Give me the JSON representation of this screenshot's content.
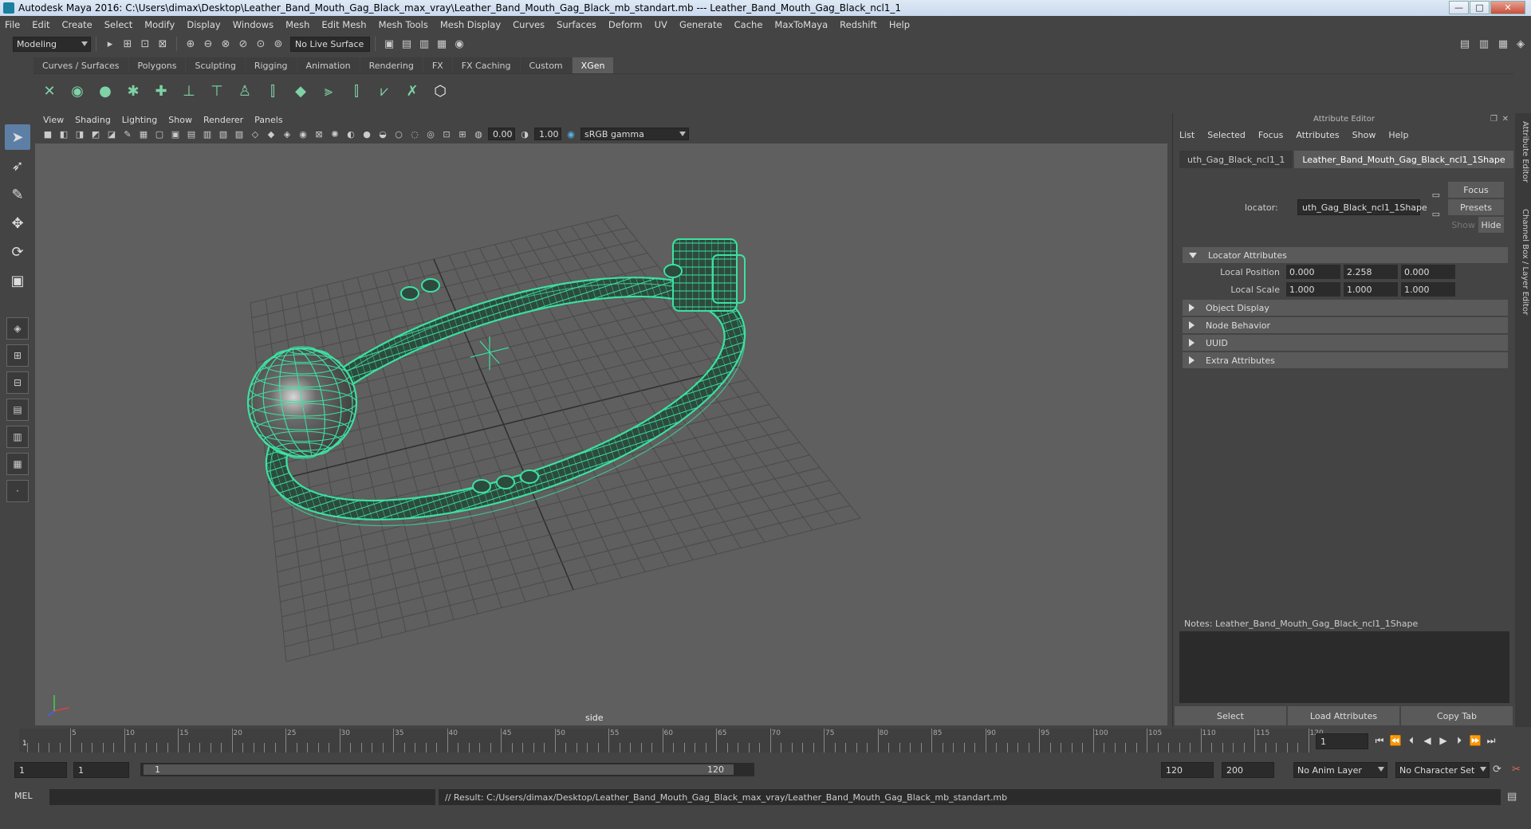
{
  "window": {
    "title": "Autodesk Maya 2016: C:\\Users\\dimax\\Desktop\\Leather_Band_Mouth_Gag_Black_max_vray\\Leather_Band_Mouth_Gag_Black_mb_standart.mb   ---   Leather_Band_Mouth_Gag_Black_ncl1_1",
    "minimize": "—",
    "maximize": "□",
    "close": "✕"
  },
  "menubar": [
    "File",
    "Edit",
    "Create",
    "Select",
    "Modify",
    "Display",
    "Windows",
    "Mesh",
    "Edit Mesh",
    "Mesh Tools",
    "Mesh Display",
    "Curves",
    "Surfaces",
    "Deform",
    "UV",
    "Generate",
    "Cache",
    "MaxToMaya",
    "Redshift",
    "Help"
  ],
  "statusline": {
    "mode": "Modeling",
    "live_surface": "No Live Surface"
  },
  "shelf_tabs": [
    {
      "label": "Curves / Surfaces",
      "active": false
    },
    {
      "label": "Polygons",
      "active": false
    },
    {
      "label": "Sculpting",
      "active": false
    },
    {
      "label": "Rigging",
      "active": false
    },
    {
      "label": "Animation",
      "active": false
    },
    {
      "label": "Rendering",
      "active": false
    },
    {
      "label": "FX",
      "active": false
    },
    {
      "label": "FX Caching",
      "active": false
    },
    {
      "label": "Custom",
      "active": false
    },
    {
      "label": "XGen",
      "active": true
    }
  ],
  "viewport": {
    "menu": [
      "View",
      "Shading",
      "Lighting",
      "Show",
      "Renderer",
      "Panels"
    ],
    "exposure": "0.00",
    "gamma": "1.00",
    "color_space": "sRGB gamma",
    "camera": "side",
    "wire_color": "#3de0a0",
    "bg_color": "#5f5f5f"
  },
  "attribute_editor": {
    "title": "Attribute Editor",
    "menu": [
      "List",
      "Selected",
      "Focus",
      "Attributes",
      "Show",
      "Help"
    ],
    "tabs": [
      "uth_Gag_Black_ncl1_1",
      "Leather_Band_Mouth_Gag_Black_ncl1_1Shape"
    ],
    "buttons": {
      "focus": "Focus",
      "presets": "Presets",
      "show": "Show",
      "hide": "Hide"
    },
    "locator_label": "locator:",
    "locator_value": "uth_Gag_Black_ncl1_1Shape",
    "sections": {
      "locator_attributes": "Locator Attributes",
      "object_display": "Object Display",
      "node_behavior": "Node Behavior",
      "uuid": "UUID",
      "extra_attributes": "Extra Attributes"
    },
    "local_position": {
      "label": "Local Position",
      "x": "0.000",
      "y": "2.258",
      "z": "0.000"
    },
    "local_scale": {
      "label": "Local Scale",
      "x": "1.000",
      "y": "1.000",
      "z": "1.000"
    },
    "notes_label": "Notes:",
    "notes_value": "Leather_Band_Mouth_Gag_Black_ncl1_1Shape",
    "bottom_buttons": [
      "Select",
      "Load Attributes",
      "Copy Tab"
    ]
  },
  "side_tabs": [
    "Attribute Editor",
    "Channel Box / Layer Editor"
  ],
  "timeline": {
    "ticks": [
      "5",
      "10",
      "15",
      "20",
      "25",
      "30",
      "35",
      "40",
      "45",
      "50",
      "55",
      "60",
      "65",
      "70",
      "75",
      "80",
      "85",
      "90",
      "95",
      "100",
      "105",
      "110",
      "115",
      "120"
    ],
    "start_marker": "1",
    "current_frame": "1"
  },
  "range": {
    "start": "1",
    "start2": "1",
    "slider_start": "1",
    "slider_end": "120",
    "end": "120",
    "end2": "200",
    "anim_layer": "No Anim Layer",
    "character_set": "No Character Set"
  },
  "cmdline": {
    "lang": "MEL",
    "result": "// Result: C:/Users/dimax/Desktop/Leather_Band_Mouth_Gag_Black_max_vray/Leather_Band_Mouth_Gag_Black_mb_standart.mb"
  }
}
